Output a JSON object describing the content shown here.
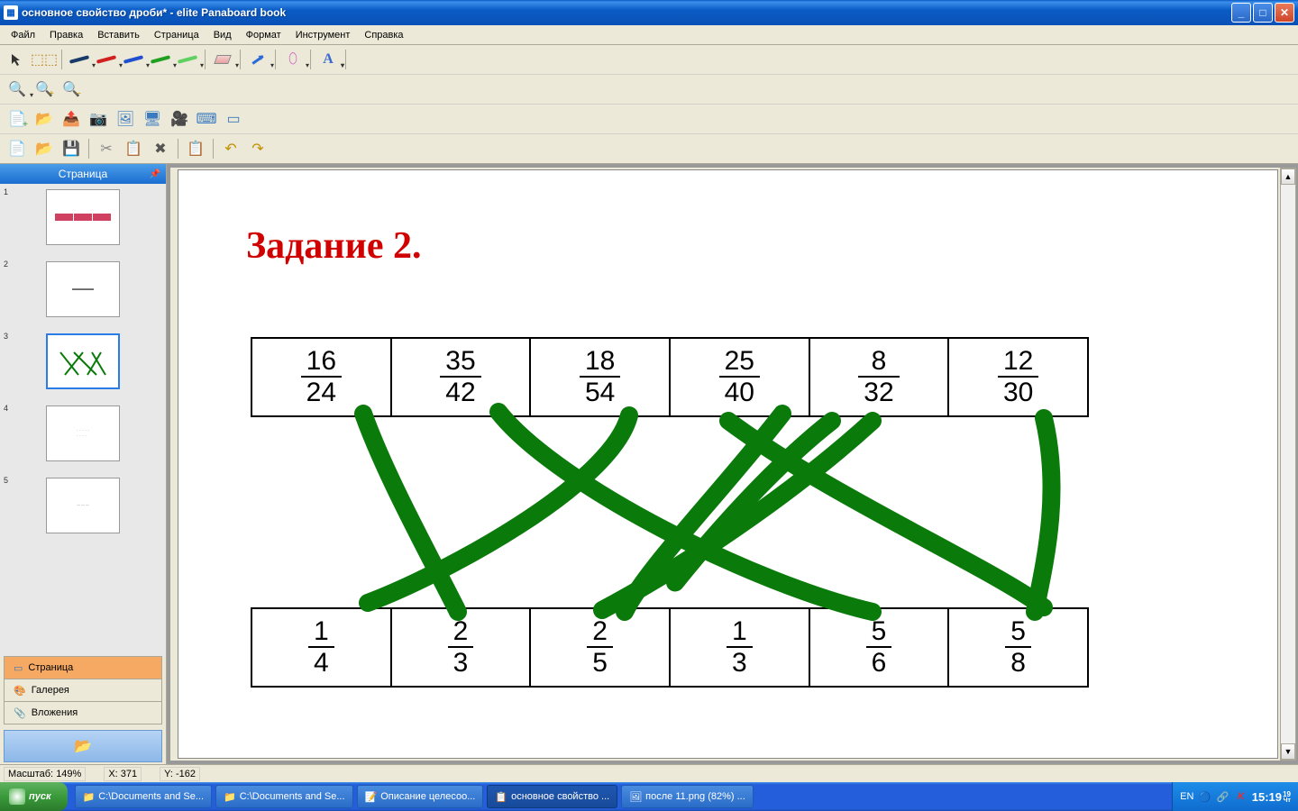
{
  "window": {
    "title": "основное свойство дроби* - elite Panaboard book"
  },
  "menu": [
    "Файл",
    "Правка",
    "Вставить",
    "Страница",
    "Вид",
    "Формат",
    "Инструмент",
    "Справка"
  ],
  "sidebar": {
    "header": "Страница",
    "tabs": {
      "page": "Страница",
      "gallery": "Галерея",
      "attach": "Вложения"
    },
    "thumb_count": 5,
    "active_thumb_index": 2
  },
  "page": {
    "title": "Задание 2.",
    "top_fracs": [
      {
        "n": "16",
        "d": "24"
      },
      {
        "n": "35",
        "d": "42"
      },
      {
        "n": "18",
        "d": "54"
      },
      {
        "n": "25",
        "d": "40"
      },
      {
        "n": "8",
        "d": "32"
      },
      {
        "n": "12",
        "d": "30"
      }
    ],
    "bot_fracs": [
      {
        "n": "1",
        "d": "4"
      },
      {
        "n": "2",
        "d": "3"
      },
      {
        "n": "2",
        "d": "5"
      },
      {
        "n": "1",
        "d": "3"
      },
      {
        "n": "5",
        "d": "6"
      },
      {
        "n": "5",
        "d": "8"
      }
    ]
  },
  "status": {
    "scale_label": "Масштаб:",
    "scale": "149%",
    "x_label": "X:",
    "x": "371",
    "y_label": "Y:",
    "y": "-162"
  },
  "taskbar": {
    "start": "пуск",
    "tasks": [
      {
        "label": "C:\\Documents and Se...",
        "icon": "📁"
      },
      {
        "label": "C:\\Documents and Se...",
        "icon": "📁"
      },
      {
        "label": "Описание целесоо...",
        "icon": "📝"
      },
      {
        "label": "основное свойство ...",
        "icon": "📋",
        "active": true
      },
      {
        "label": "после 11.png (82%) ...",
        "icon": "🖼"
      }
    ],
    "lang": "EN",
    "clock": {
      "hm": "15:19",
      "sec": "19",
      "sub": "Чт"
    }
  }
}
